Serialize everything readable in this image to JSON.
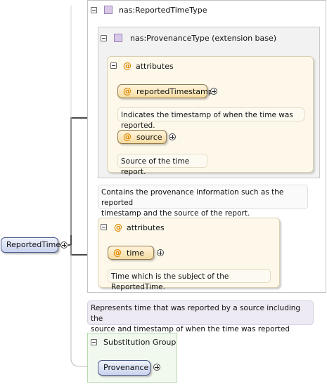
{
  "root": {
    "label": "ReportedTime"
  },
  "complex_type": {
    "title": "nas:ReportedTimeType",
    "extension": {
      "title": "nas:ProvenanceType (extension base)",
      "attributes_label": "attributes",
      "attributes": [
        {
          "name": "reportedTimestamp",
          "doc": "Indicates the timestamp of when the time was reported."
        },
        {
          "name": "source",
          "doc": "Source of the time report."
        }
      ],
      "doc_line1": "Contains the provenance information such as the reported",
      "doc_line2": "timestamp and the source of the report."
    },
    "attributes_label": "attributes",
    "attributes": [
      {
        "name": "time",
        "doc": "Time which is the subject of the ReportedTime."
      }
    ]
  },
  "root_doc_line1": "Represents time that was reported by a source including the",
  "root_doc_line2": "source and timestamp of when the time was reported",
  "substitution_group": {
    "title": "Substitution Group",
    "member": "Provenance"
  }
}
